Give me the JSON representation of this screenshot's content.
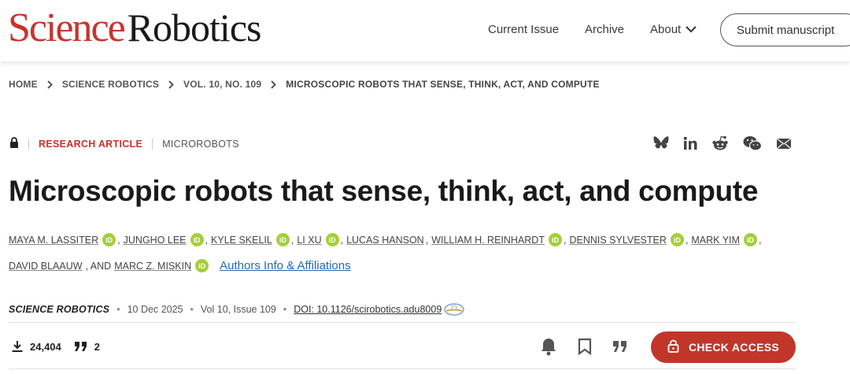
{
  "header": {
    "logo_science": "Science",
    "logo_robotics": "Robotics",
    "nav": {
      "current_issue": "Current Issue",
      "archive": "Archive",
      "about": "About"
    },
    "submit_label": "Submit manuscript"
  },
  "breadcrumb": [
    "HOME",
    "SCIENCE ROBOTICS",
    "VOL. 10, NO. 109",
    "MICROSCOPIC ROBOTS THAT SENSE, THINK, ACT, AND COMPUTE"
  ],
  "article": {
    "type": "RESEARCH ARTICLE",
    "subject": "MICROROBOTS",
    "title": "Microscopic robots that sense, think, act, and compute",
    "authors_line1": [
      "MAYA M. LASSITER",
      "JUNGHO LEE",
      "KYLE SKELIL",
      "LI XU",
      "LUCAS HANSON",
      "WILLIAM H. REINHARDT",
      "DENNIS SYLVESTER",
      "MARK YIM"
    ],
    "authors_line2": [
      "DAVID BLAAUW",
      "MARC Z. MISKIN"
    ],
    "and_text": ", AND",
    "affiliations_link": "Authors Info & Affiliations",
    "orcid_label": "iD",
    "journal": "SCIENCE ROBOTICS",
    "date": "10 Dec 2025",
    "volume": "Vol 10, Issue 109",
    "doi": "DOI: 10.1126/scirobotics.adu8009"
  },
  "stats": {
    "downloads": "24,404",
    "citations": "2"
  },
  "check_access_label": "CHECK ACCESS",
  "colors": {
    "brand_red": "#c8332b",
    "orcid_green": "#a6ce39",
    "link_blue": "#2a67b1",
    "button_red": "#c2362a"
  },
  "icons": {
    "lock": "lock-icon",
    "bluesky": "bluesky-icon",
    "linkedin": "linkedin-icon",
    "reddit": "reddit-icon",
    "wechat": "wechat-icon",
    "email": "email-icon",
    "download": "download-icon",
    "quote": "quote-icon",
    "bell": "bell-icon",
    "bookmark": "bookmark-icon",
    "cite": "cite-icon",
    "chevron": "chevron-right-icon"
  }
}
